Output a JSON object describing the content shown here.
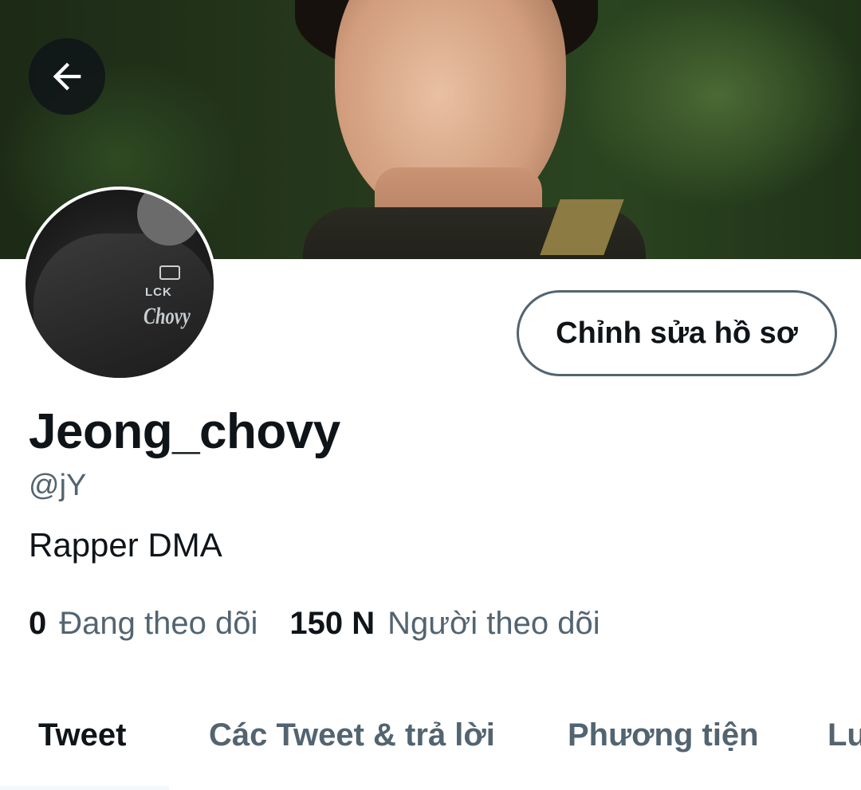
{
  "header": {
    "back_icon": "arrow-left-icon"
  },
  "avatar": {
    "jersey_brand": "LCK",
    "jersey_name": "Chovy"
  },
  "actions": {
    "edit_profile_label": "Chỉnh sửa hồ sơ"
  },
  "profile": {
    "display_name": "Jeong_chovy",
    "handle": "@jY",
    "bio": "Rapper DMA"
  },
  "stats": {
    "following_count": "0",
    "following_label": "Đang theo dõi",
    "followers_count": "150 N",
    "followers_label": "Người theo dõi"
  },
  "tabs": [
    {
      "label": "Tweet",
      "active": true
    },
    {
      "label": "Các Tweet & trả lời",
      "active": false
    },
    {
      "label": "Phương tiện",
      "active": false
    },
    {
      "label": "Lu",
      "active": false
    }
  ],
  "colors": {
    "text_primary": "#0f1419",
    "text_secondary": "#536471",
    "button_border": "#536471"
  }
}
